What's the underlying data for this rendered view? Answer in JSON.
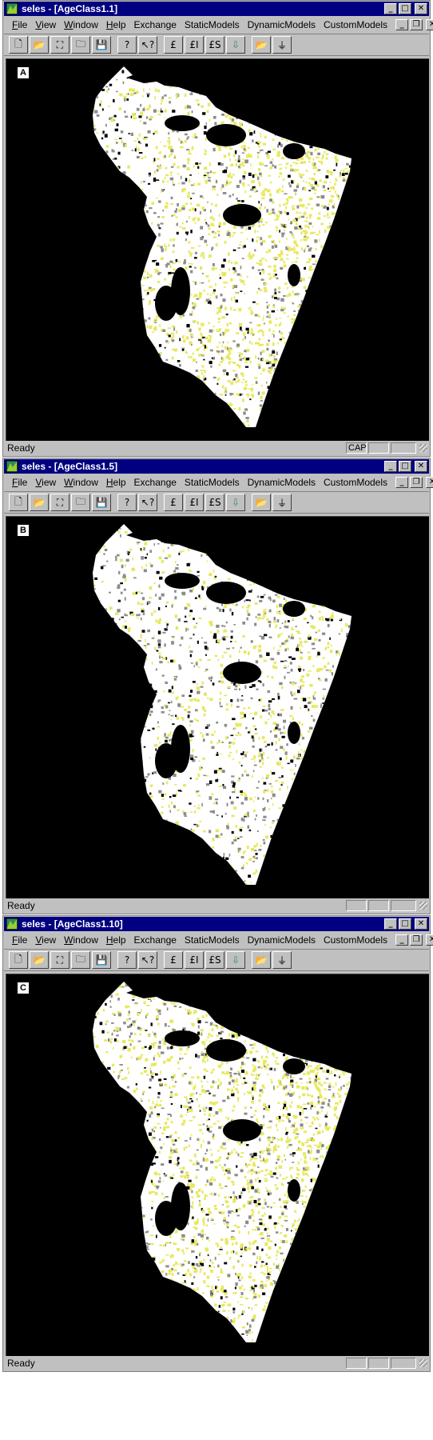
{
  "windows": [
    {
      "title": "seles - [AgeClass1.1]",
      "panel_label": "A",
      "status": "Ready",
      "status_indicators": [
        "CAP",
        "",
        ""
      ],
      "density": 0.55
    },
    {
      "title": "seles - [AgeClass1.5]",
      "panel_label": "B",
      "status": "Ready",
      "status_indicators": [
        "",
        "",
        ""
      ],
      "density": 0.3
    },
    {
      "title": "seles - [AgeClass1.10]",
      "panel_label": "C",
      "status": "Ready",
      "status_indicators": [
        "",
        "",
        ""
      ],
      "density": 0.65
    }
  ],
  "menu": [
    {
      "label": "File",
      "accel": "F"
    },
    {
      "label": "View",
      "accel": "V"
    },
    {
      "label": "Window",
      "accel": "W"
    },
    {
      "label": "Help",
      "accel": "H"
    },
    {
      "label": "Exchange",
      "accel": ""
    },
    {
      "label": "StaticModels",
      "accel": ""
    },
    {
      "label": "DynamicModels",
      "accel": ""
    },
    {
      "label": "CustomModels",
      "accel": ""
    }
  ],
  "toolbar": [
    {
      "name": "new-icon",
      "glyph": "🗋"
    },
    {
      "name": "open-folder-icon",
      "glyph": "📂"
    },
    {
      "name": "open-landscape-icon",
      "glyph": "⛶"
    },
    {
      "name": "open-multiple-icon",
      "glyph": "🗀"
    },
    {
      "name": "save-icon",
      "glyph": "💾"
    },
    {
      "name": "help-icon",
      "glyph": "?"
    },
    {
      "name": "context-help-icon",
      "glyph": "↖?"
    },
    {
      "name": "function-icon",
      "glyph": "£"
    },
    {
      "name": "function-i-icon",
      "glyph": "£I"
    },
    {
      "name": "function-s-icon",
      "glyph": "£S"
    },
    {
      "name": "down-arrow-icon",
      "glyph": "⇩"
    },
    {
      "name": "open-model-icon",
      "glyph": "📂"
    },
    {
      "name": "run-icon",
      "glyph": "⏚"
    }
  ],
  "colors": {
    "titlebar": "#000080",
    "chrome": "#c0c0c0",
    "map_background": "#000000",
    "landscape": "#ffffff",
    "age_class": "#e8e860",
    "other_class": "#8c8c8c",
    "icon_green": "#2e8b57"
  }
}
